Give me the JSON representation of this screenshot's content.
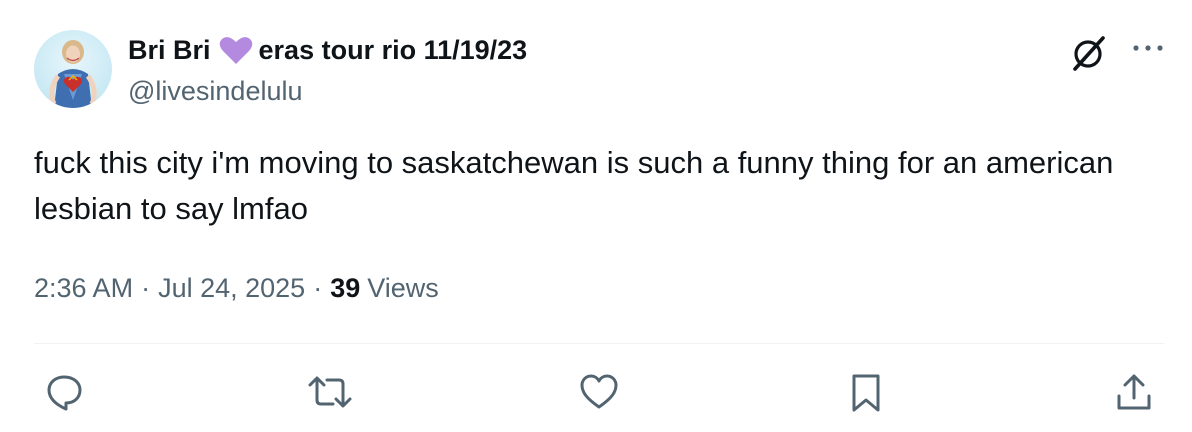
{
  "author": {
    "name": "Bri Bri",
    "name_suffix": "eras tour rio 11/19/23",
    "handle": "@livesindelulu"
  },
  "tweet": {
    "text": "fuck this city i'm moving to saskatchewan is such a funny thing for an american lesbian to say lmfao",
    "time": "2:36 AM",
    "date": "Jul 24, 2025",
    "separator": "·",
    "views_count": "39",
    "views_label": "Views"
  },
  "icons": {
    "heart_emoji": "purple-heart-icon",
    "grok": "grok-icon",
    "more": "more-icon",
    "reply": "reply-icon",
    "retweet": "retweet-icon",
    "like": "like-icon",
    "bookmark": "bookmark-icon",
    "share": "share-icon"
  },
  "colors": {
    "text_primary": "#0f1419",
    "text_secondary": "#536471",
    "divider": "#eff3f4",
    "heart": "#b489e0"
  }
}
